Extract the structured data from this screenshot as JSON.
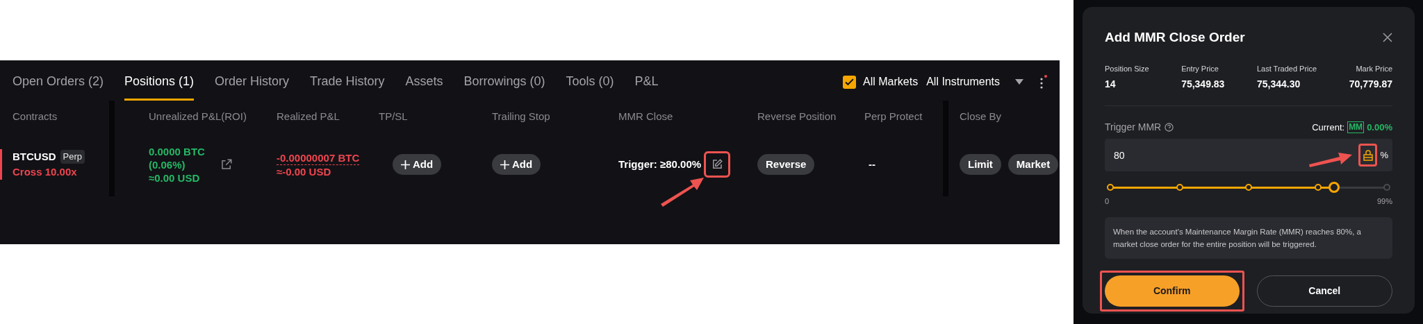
{
  "tabs": [
    {
      "label": "Open Orders (2)",
      "selected": false
    },
    {
      "label": "Positions (1)",
      "selected": true
    },
    {
      "label": "Order History",
      "selected": false
    },
    {
      "label": "Trade History",
      "selected": false
    },
    {
      "label": "Assets",
      "selected": false
    },
    {
      "label": "Borrowings (0)",
      "selected": false
    },
    {
      "label": "Tools (0)",
      "selected": false
    },
    {
      "label": "P&L",
      "selected": false
    }
  ],
  "filters": {
    "all_markets": {
      "label": "All Markets",
      "checked": true
    },
    "instruments": "All Instruments"
  },
  "columns": [
    "Contracts",
    "Unrealized P&L(ROI)",
    "Realized P&L",
    "TP/SL",
    "Trailing Stop",
    "MMR Close",
    "Reverse Position",
    "Perp Protect",
    "Close By"
  ],
  "position": {
    "contract": "BTCUSD",
    "badge": "Perp",
    "margin": "Cross 10.00x",
    "unrealized": [
      "0.0000 BTC",
      "(0.06%)",
      "≈0.00 USD"
    ],
    "realized": [
      "-0.00000007 BTC",
      "≈-0.00 USD"
    ],
    "tp_sl_button": "Add",
    "trailing_stop_button": "Add",
    "mmr_close": "Trigger: ≥80.00%",
    "mmr_edit_highlighted": true,
    "reverse_button": "Reverse",
    "perp_protect": "--",
    "close_by": [
      "Limit",
      "Market"
    ]
  },
  "dialog": {
    "title": "Add MMR Close Order",
    "stats": [
      {
        "label": "Position Size",
        "value": "14"
      },
      {
        "label": "Entry Price",
        "value": "75,349.83"
      },
      {
        "label": "Last Traded Price",
        "value": "75,344.30"
      },
      {
        "label": "Mark Price",
        "value": "70,779.87"
      }
    ],
    "trigger_label": "Trigger MMR",
    "current_label": "Current:",
    "current_badge": "MM",
    "current_value": "0.00%",
    "value": "80",
    "unit": "%",
    "lock_highlighted": true,
    "slider": {
      "level": 0.81,
      "min_label": "0",
      "max_label": "99%"
    },
    "note": "When the account's Maintenance Margin Rate (MMR) reaches 80%, a market close order for the entire position will be triggered.",
    "confirm": {
      "label": "Confirm",
      "highlighted": true
    },
    "cancel": "Cancel"
  }
}
